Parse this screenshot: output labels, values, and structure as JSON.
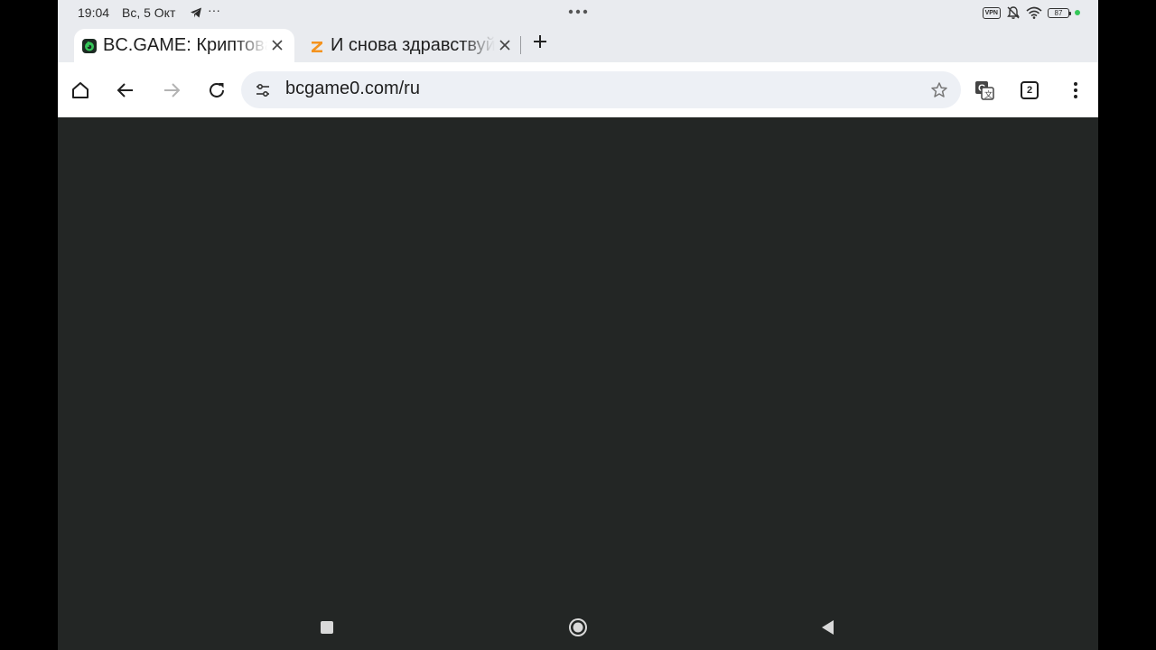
{
  "status_bar": {
    "time": "19:04",
    "date": "Вс, 5 Окт",
    "more_notifications": "···",
    "vpn_label": "VPN",
    "battery": "87"
  },
  "tabs": [
    {
      "title": "BC.GAME: Криптовалютное казино",
      "active": true,
      "favicon": "bcgame-favicon"
    },
    {
      "title": "И снова здравствуйте",
      "active": false,
      "favicon": "zen-favicon"
    }
  ],
  "toolbar": {
    "url": "bcgame0.com/ru",
    "tab_count": "2"
  },
  "colors": {
    "accent_green": "#35c759",
    "content_bg": "#232625",
    "chrome_bg": "#e9ebef"
  }
}
